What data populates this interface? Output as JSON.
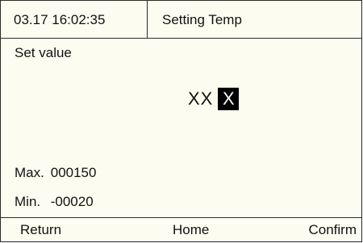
{
  "header": {
    "datetime": "03.17 16:02:35",
    "title": "Setting Temp"
  },
  "main": {
    "set_label": "Set value",
    "value_fixed": "XX",
    "value_cursor": "X",
    "max_label": "Max.",
    "max_value": "000150",
    "min_label": "Min.",
    "min_value": "-00020"
  },
  "footer": {
    "return_label": "Return",
    "home_label": "Home",
    "confirm_label": "Confirm"
  }
}
